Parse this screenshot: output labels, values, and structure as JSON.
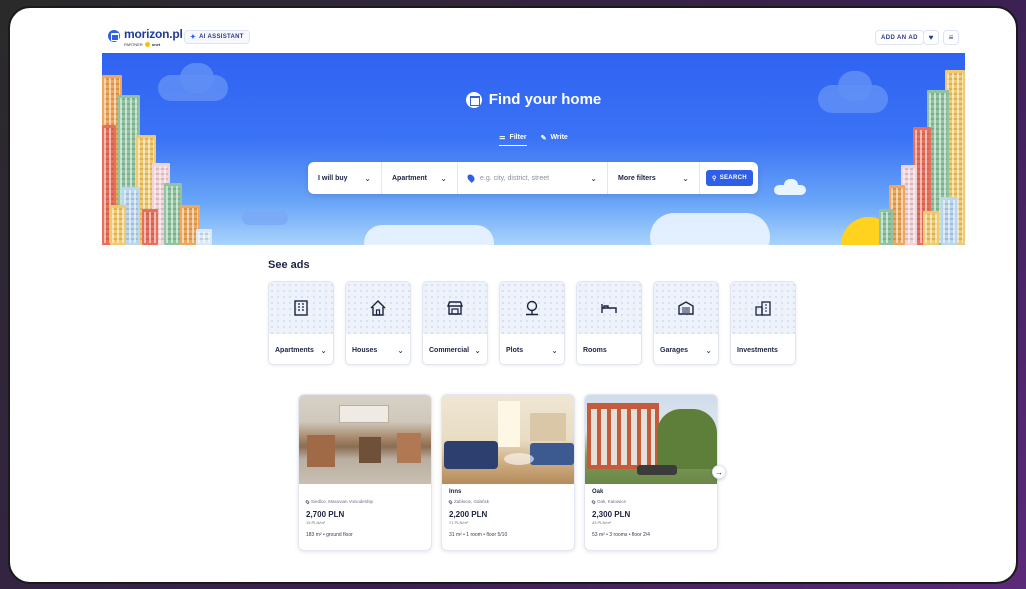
{
  "header": {
    "logo_text": "morizon.pl",
    "logo_partner": "PARTNER",
    "logo_partner_brand": "onet",
    "ai_assistant_label": "AI ASSISTANT",
    "add_ad_label": "ADD AN AD",
    "favorites_icon": "heart-icon",
    "menu_icon": "hamburger-menu-icon"
  },
  "hero": {
    "title": "Find your home",
    "tabs": [
      {
        "label": "Filter",
        "icon": "sliders-icon",
        "active": true
      },
      {
        "label": "Write",
        "icon": "pencil-icon",
        "active": false
      }
    ],
    "search": {
      "transaction": "I will buy",
      "property_type": "Apartment",
      "location_placeholder": "e.g. city, district, street",
      "more_filters": "More filters",
      "search_button": "SEARCH"
    }
  },
  "see_ads": {
    "title": "See ads",
    "categories": [
      {
        "label": "Apartments",
        "icon": "apartment-building-icon",
        "has_dropdown": true
      },
      {
        "label": "Houses",
        "icon": "house-icon",
        "has_dropdown": true
      },
      {
        "label": "Commercial",
        "icon": "storefront-icon",
        "has_dropdown": true
      },
      {
        "label": "Plots",
        "icon": "tree-plot-icon",
        "has_dropdown": true
      },
      {
        "label": "Rooms",
        "icon": "bed-icon",
        "has_dropdown": false
      },
      {
        "label": "Garages",
        "icon": "garage-icon",
        "has_dropdown": true
      },
      {
        "label": "Investments",
        "icon": "investment-buildings-icon",
        "has_dropdown": false
      }
    ]
  },
  "listings": [
    {
      "title": "",
      "location": "Siedlce, Masovian Voivodeship",
      "price": "2,700 PLN",
      "price_per_m2": "15 PLN/m²",
      "details": "183 m² • ground floor"
    },
    {
      "title": "Inns",
      "location": "Zabłocie, Gdańsk",
      "price": "2,200 PLN",
      "price_per_m2": "71 PLN/m²",
      "details": "31 m² • 1 room • floor 5/10"
    },
    {
      "title": "Oak",
      "location": "Oak, Katowice",
      "price": "2,300 PLN",
      "price_per_m2": "43 PLN/m²",
      "details": "53 m² • 3 rooms • floor 2/4"
    }
  ],
  "colors": {
    "brand_blue": "#2f5fe6",
    "text_dark": "#1c2340",
    "hero_sky_top": "#2f62f2",
    "sun": "#ffd21f"
  }
}
